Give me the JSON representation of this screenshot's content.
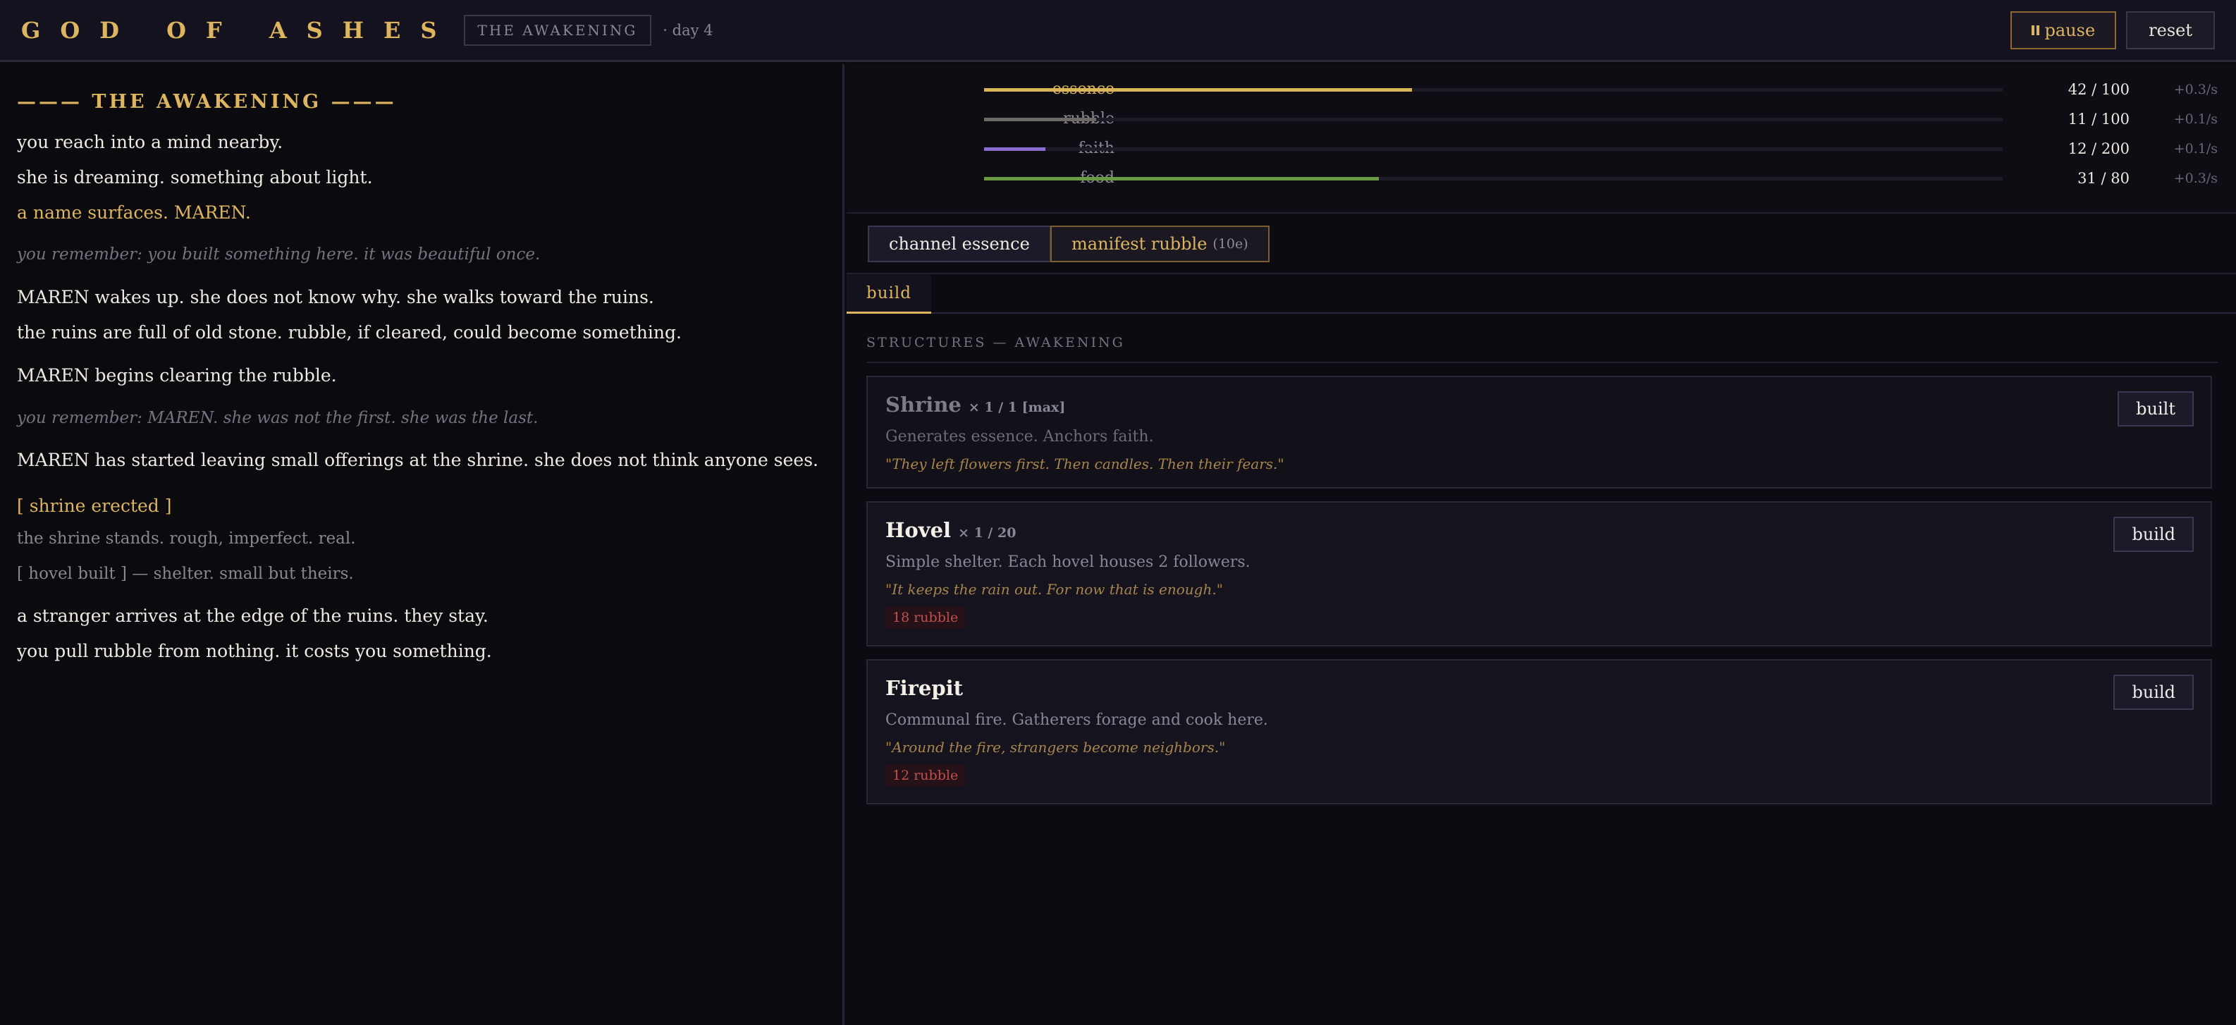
{
  "header": {
    "title": "GOD OF ASHES",
    "chapter": "THE AWAKENING",
    "day": "· day 4",
    "pause_label": "pause",
    "reset_label": "reset"
  },
  "log": {
    "heading": "——— THE AWAKENING ———",
    "lines": [
      {
        "text": "you reach into a mind nearby.",
        "style": "normal"
      },
      {
        "text": "she is dreaming. something about light.",
        "style": "normal"
      },
      {
        "text": "a name surfaces. MAREN.",
        "style": "gold"
      },
      {
        "text": "you remember: you built something here. it was beautiful once.",
        "style": "memory"
      },
      {
        "text": "MAREN wakes up. she does not know why. she walks toward the ruins.",
        "style": "normal"
      },
      {
        "text": "the ruins are full of old stone. rubble, if cleared, could become something.",
        "style": "normal"
      },
      {
        "text": "MAREN begins clearing the rubble.",
        "style": "normal"
      },
      {
        "text": "you remember: MAREN. she was not the first. she was the last.",
        "style": "memory"
      },
      {
        "text": "MAREN has started leaving small offerings at the shrine. she does not think anyone sees.",
        "style": "normal"
      },
      {
        "text": "[ shrine erected ]",
        "style": "gold"
      },
      {
        "text": "the shrine stands. rough, imperfect. real.",
        "style": "dim"
      },
      {
        "text": "[ hovel built ] — shelter. small but theirs.",
        "style": "dim"
      },
      {
        "text": "a stranger arrives at the edge of the ruins. they stay.",
        "style": "normal"
      },
      {
        "text": "you pull rubble from nothing. it costs you something.",
        "style": "normal"
      }
    ]
  },
  "resources": [
    {
      "name": "essence",
      "current": 42,
      "max": 100,
      "value": "42 / 100",
      "rate": "+0.3/s",
      "color": "#d9b55a",
      "fill_fraction": 0.42
    },
    {
      "name": "rubble",
      "current": 11,
      "max": 100,
      "value": "11 / 100",
      "rate": "+0.1/s",
      "color": "#6e6a66",
      "fill_fraction": 0.11
    },
    {
      "name": "faith",
      "current": 12,
      "max": 200,
      "value": "12 / 200",
      "rate": "+0.1/s",
      "color": "#8a6fd0",
      "fill_fraction": 0.06
    },
    {
      "name": "food",
      "current": 31,
      "max": 80,
      "value": "31 / 80",
      "rate": "+0.3/s",
      "color": "#6a9a42",
      "fill_fraction": 0.3875
    }
  ],
  "actions": {
    "channel_label": "channel essence",
    "manifest_label": "manifest rubble",
    "manifest_cost": "(10e)"
  },
  "tabs": {
    "build_label": "build"
  },
  "structures": {
    "section_title": "STRUCTURES — AWAKENING",
    "items": [
      {
        "name": "Shrine",
        "count": "× 1 / 1 [max]",
        "description": "Generates essence. Anchors faith.",
        "quote": "\"They left flowers first. Then candles. Then their fears.\"",
        "cost": "",
        "button": "built"
      },
      {
        "name": "Hovel",
        "count": "× 1 / 20",
        "description": "Simple shelter. Each hovel houses 2 followers.",
        "quote": "\"It keeps the rain out. For now that is enough.\"",
        "cost": "18 rubble",
        "button": "build"
      },
      {
        "name": "Firepit",
        "count": "",
        "description": "Communal fire. Gatherers forage and cook here.",
        "quote": "\"Around the fire, strangers become neighbors.\"",
        "cost": "12 rubble",
        "button": "build"
      }
    ]
  }
}
